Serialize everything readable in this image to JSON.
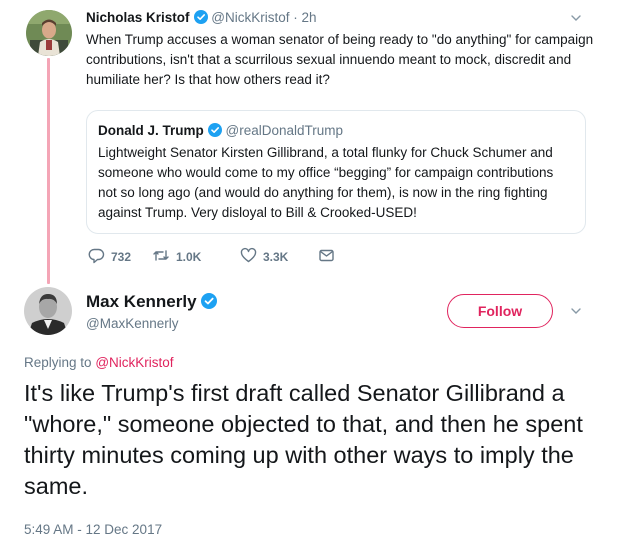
{
  "colors": {
    "accent": "#e0245e",
    "verified": "#1da1f2",
    "thread_line": "#f4a5b6",
    "secondary_text": "#657786"
  },
  "original_tweet": {
    "author_name": "Nicholas Kristof",
    "author_handle": "@NickKristof",
    "separator": "·",
    "time": "2h",
    "text": "When Trump accuses a woman senator of being ready to \"do anything\" for campaign contributions, isn't that a scurrilous sexual innuendo meant to mock, discredit and humiliate her? Is that how others read it?",
    "quoted": {
      "author_name": "Donald J. Trump",
      "author_handle": "@realDonaldTrump",
      "text": "Lightweight Senator Kirsten Gillibrand, a total flunky for Chuck Schumer and someone who would come to my office “begging” for campaign contributions not so long ago (and would do anything for them), is now in the ring fighting against Trump. Very disloyal to Bill & Crooked-USED!"
    },
    "actions": {
      "replies": "732",
      "retweets": "1.0K",
      "likes": "3.3K"
    }
  },
  "reply_tweet": {
    "author_name": "Max Kennerly",
    "author_handle": "@MaxKennerly",
    "follow_label": "Follow",
    "replying_prefix": "Replying to",
    "replying_to": "@NickKristof",
    "text": "It's like Trump's first draft called Senator Gillibrand a \"whore,\" someone objected to that, and then he spent thirty minutes coming up with other ways to imply the same.",
    "timestamp": "5:49 AM - 12 Dec 2017"
  }
}
